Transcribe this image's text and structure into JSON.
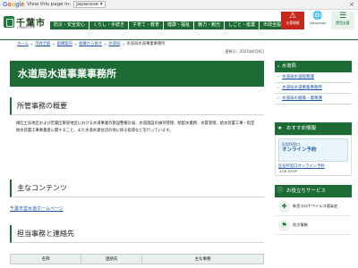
{
  "translate_bar": {
    "logo": [
      "G",
      "o",
      "o",
      "g",
      "l",
      "e"
    ],
    "text": "View this page in:",
    "language": "Japanese",
    "button_arrow": "▾"
  },
  "header": {
    "city_name": "千葉市",
    "city_sub": "CHIBA CITY",
    "nav": [
      "防災・安全安心",
      "くらし・手続き",
      "子育て・教育",
      "健康・福祉",
      "魅力・観光",
      "しごと・産業",
      "市政全般"
    ],
    "tiles": [
      {
        "symbol": "⚠",
        "label": "災害情報"
      },
      {
        "symbol": "🌐",
        "label": "Language"
      },
      {
        "symbol": "☰",
        "label": "閲覧支援"
      }
    ]
  },
  "breadcrumb": [
    "ホーム",
    "市政全般",
    "組織案内",
    "組織から探す",
    "水道局",
    "水道局水道事業事務所"
  ],
  "updated": "更新日：2021年6月6日",
  "page_title": "水道局水道事業事務所",
  "sections": {
    "overview_heading": "所管事務の概要",
    "overview_body": "緑区土気地区および若葉区東部地区における水道事業の施設整備計画、水道施設の維持管理、給配水業務、水質管理、給水装置工事・指定給水装置工事事業者に関すること、また水道水源位切の地に係る指導などを行っています。",
    "contents_heading": "主なコンテンツ",
    "contents_link": "千葉市営水道ホームページ",
    "contact_heading": "担当事務と連絡先",
    "table_headers": [
      "名称",
      "連絡先",
      "主な事務"
    ]
  },
  "sidebar": {
    "section_title": "水道局",
    "items": [
      "水道局水道総務課",
      "水道局水道事業事務所",
      "水道局の組織・業務課"
    ],
    "recommend_title": "おすすめ情報",
    "recommend_banner_line1": "区役所窓口",
    "recommend_banner_line2": "オンライン予約",
    "recommend_link": "区役所窓口オンライン予約",
    "recommend_pager": "1/16 STOP",
    "services_title": "お役立ちサービス",
    "services": [
      {
        "icon": "✚",
        "label": "新型コロナウイルス感染症"
      },
      {
        "icon": "⚑",
        "label": "防災情報"
      }
    ]
  },
  "colors": {
    "brand_green": "#1d6b35",
    "alert_red": "#c5291e",
    "link_blue": "#1b55a8"
  }
}
